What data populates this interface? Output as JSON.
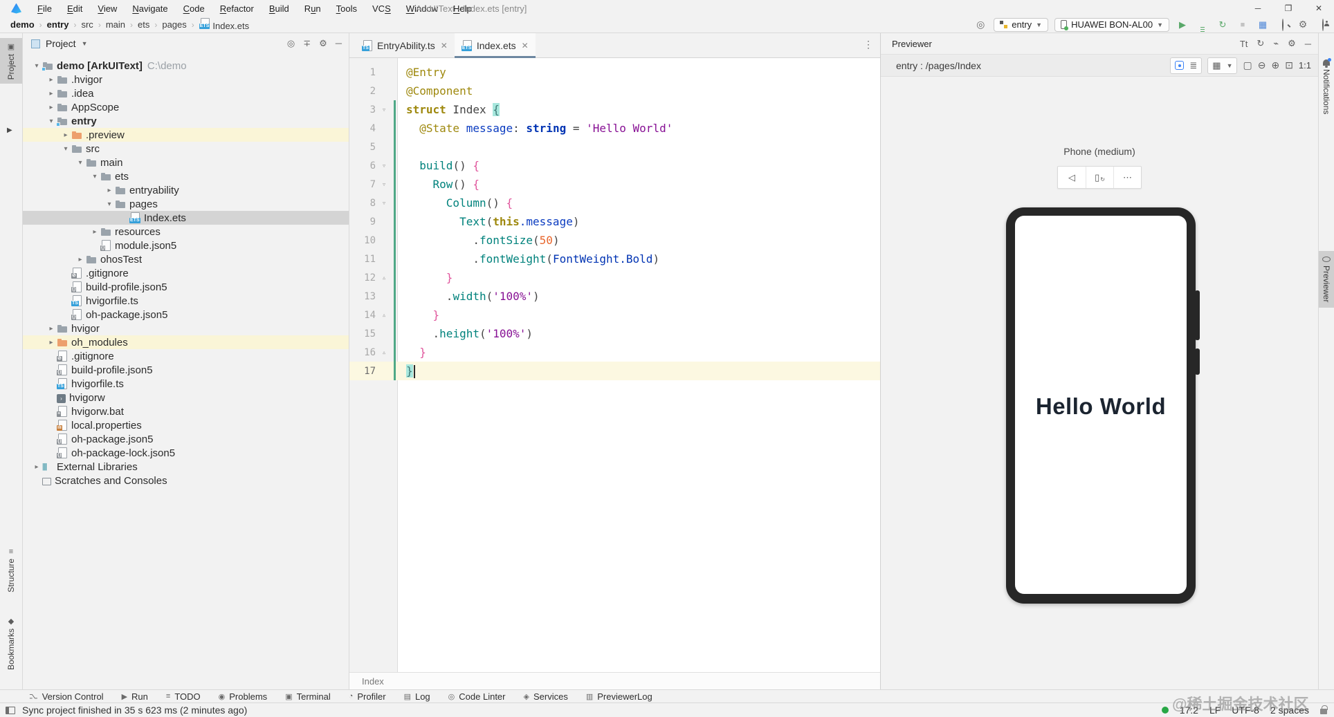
{
  "window": {
    "title": "ArkUIText - Index.ets [entry]"
  },
  "menubar": {
    "items": [
      {
        "label": "File",
        "mnemonic": 0
      },
      {
        "label": "Edit",
        "mnemonic": 0
      },
      {
        "label": "View",
        "mnemonic": 0
      },
      {
        "label": "Navigate",
        "mnemonic": 0
      },
      {
        "label": "Code",
        "mnemonic": 0
      },
      {
        "label": "Refactor",
        "mnemonic": 0
      },
      {
        "label": "Build",
        "mnemonic": 0
      },
      {
        "label": "Run",
        "mnemonic": 1
      },
      {
        "label": "Tools",
        "mnemonic": 0
      },
      {
        "label": "VCS",
        "mnemonic": 2
      },
      {
        "label": "Window",
        "mnemonic": 0
      },
      {
        "label": "Help",
        "mnemonic": 0
      }
    ]
  },
  "breadcrumbs": {
    "items": [
      "demo",
      "entry",
      "src",
      "main",
      "ets",
      "pages"
    ],
    "file": "Index.ets"
  },
  "toolbar": {
    "module": "entry",
    "device": "HUAWEI BON-AL00"
  },
  "left_stripe": {
    "tabs": [
      "Project",
      "Structure",
      "Bookmarks"
    ]
  },
  "project_panel": {
    "title": "Project",
    "tree": [
      {
        "label": "demo [ArkUIText]",
        "hint": "C:\\demo",
        "level": 0,
        "chev": "open",
        "icon": "module",
        "bold": true
      },
      {
        "label": ".hvigor",
        "level": 1,
        "chev": "closed",
        "icon": "folder"
      },
      {
        "label": ".idea",
        "level": 1,
        "chev": "closed",
        "icon": "folder"
      },
      {
        "label": "AppScope",
        "level": 1,
        "chev": "closed",
        "icon": "folder"
      },
      {
        "label": "entry",
        "level": 1,
        "chev": "open",
        "icon": "module",
        "bold": true
      },
      {
        "label": ".preview",
        "level": 2,
        "chev": "closed",
        "icon": "folder-orange",
        "row": "flagged"
      },
      {
        "label": "src",
        "level": 2,
        "chev": "open",
        "icon": "folder"
      },
      {
        "label": "main",
        "level": 3,
        "chev": "open",
        "icon": "folder"
      },
      {
        "label": "ets",
        "level": 4,
        "chev": "open",
        "icon": "folder"
      },
      {
        "label": "entryability",
        "level": 5,
        "chev": "closed",
        "icon": "folder"
      },
      {
        "label": "pages",
        "level": 5,
        "chev": "open",
        "icon": "folder"
      },
      {
        "label": "Index.ets",
        "level": 6,
        "chev": "none",
        "icon": "ets",
        "row": "selected"
      },
      {
        "label": "resources",
        "level": 4,
        "chev": "closed",
        "icon": "folder"
      },
      {
        "label": "module.json5",
        "level": 4,
        "chev": "none",
        "icon": "json5"
      },
      {
        "label": "ohosTest",
        "level": 3,
        "chev": "closed",
        "icon": "folder"
      },
      {
        "label": ".gitignore",
        "level": 2,
        "chev": "none",
        "icon": "ignore"
      },
      {
        "label": "build-profile.json5",
        "level": 2,
        "chev": "none",
        "icon": "json5"
      },
      {
        "label": "hvigorfile.ts",
        "level": 2,
        "chev": "none",
        "icon": "ts"
      },
      {
        "label": "oh-package.json5",
        "level": 2,
        "chev": "none",
        "icon": "json5"
      },
      {
        "label": "hvigor",
        "level": 1,
        "chev": "closed",
        "icon": "folder"
      },
      {
        "label": "oh_modules",
        "level": 1,
        "chev": "closed",
        "icon": "folder-orange",
        "row": "flagged"
      },
      {
        "label": ".gitignore",
        "level": 1,
        "chev": "none",
        "icon": "ignore"
      },
      {
        "label": "build-profile.json5",
        "level": 1,
        "chev": "none",
        "icon": "json5"
      },
      {
        "label": "hvigorfile.ts",
        "level": 1,
        "chev": "none",
        "icon": "ts"
      },
      {
        "label": "hvigorw",
        "level": 1,
        "chev": "none",
        "icon": "console"
      },
      {
        "label": "hvigorw.bat",
        "level": 1,
        "chev": "none",
        "icon": "bat"
      },
      {
        "label": "local.properties",
        "level": 1,
        "chev": "none",
        "icon": "props"
      },
      {
        "label": "oh-package.json5",
        "level": 1,
        "chev": "none",
        "icon": "json5"
      },
      {
        "label": "oh-package-lock.json5",
        "level": 1,
        "chev": "none",
        "icon": "json5"
      },
      {
        "label": "External Libraries",
        "level": 0,
        "chev": "closed",
        "icon": "lib"
      },
      {
        "label": "Scratches and Consoles",
        "level": 0,
        "chev": "none",
        "icon": "scratch"
      }
    ]
  },
  "editor": {
    "tabs": [
      {
        "label": "EntryAbility.ts",
        "kind": "ts",
        "active": false
      },
      {
        "label": "Index.ets",
        "kind": "ets",
        "active": true
      }
    ],
    "breadcrumb": "Index",
    "lines": [
      {
        "n": 1,
        "tok": [
          [
            "ann",
            "@Entry"
          ]
        ]
      },
      {
        "n": 2,
        "tok": [
          [
            "ann",
            "@Component"
          ]
        ]
      },
      {
        "n": 3,
        "fold": "open",
        "changed": true,
        "tok": [
          [
            "kw",
            "struct"
          ],
          [
            "pl",
            " Index "
          ],
          [
            "brhl",
            "{"
          ]
        ]
      },
      {
        "n": 4,
        "changed": true,
        "tok": [
          [
            "pl",
            "  "
          ],
          [
            "ann",
            "@State"
          ],
          [
            "pl",
            " "
          ],
          [
            "prop",
            "message"
          ],
          [
            "pl",
            ": "
          ],
          [
            "kwb",
            "string"
          ],
          [
            "pl",
            " = "
          ],
          [
            "str",
            "'Hello World'"
          ]
        ]
      },
      {
        "n": 5,
        "changed": true,
        "tok": []
      },
      {
        "n": 6,
        "fold": "open",
        "changed": true,
        "tok": [
          [
            "pl",
            "  "
          ],
          [
            "fn",
            "build"
          ],
          [
            "pl",
            "() "
          ],
          [
            "br",
            "{"
          ]
        ]
      },
      {
        "n": 7,
        "fold": "open",
        "changed": true,
        "tok": [
          [
            "pl",
            "    "
          ],
          [
            "fn",
            "Row"
          ],
          [
            "pl",
            "() "
          ],
          [
            "br",
            "{"
          ]
        ]
      },
      {
        "n": 8,
        "fold": "open",
        "changed": true,
        "tok": [
          [
            "pl",
            "      "
          ],
          [
            "fn",
            "Column"
          ],
          [
            "pl",
            "() "
          ],
          [
            "br",
            "{"
          ]
        ]
      },
      {
        "n": 9,
        "changed": true,
        "tok": [
          [
            "pl",
            "        "
          ],
          [
            "fn",
            "Text"
          ],
          [
            "pl",
            "("
          ],
          [
            "kw",
            "this"
          ],
          [
            "prop",
            ".message"
          ],
          [
            "pl",
            ")"
          ]
        ]
      },
      {
        "n": 10,
        "changed": true,
        "tok": [
          [
            "pl",
            "          ."
          ],
          [
            "fn",
            "fontSize"
          ],
          [
            "pl",
            "("
          ],
          [
            "num",
            "50"
          ],
          [
            "pl",
            ")"
          ]
        ]
      },
      {
        "n": 11,
        "changed": true,
        "tok": [
          [
            "pl",
            "          ."
          ],
          [
            "fn",
            "fontWeight"
          ],
          [
            "pl",
            "("
          ],
          [
            "cls",
            "FontWeight.Bold"
          ],
          [
            "pl",
            ")"
          ]
        ]
      },
      {
        "n": 12,
        "fold": "close",
        "changed": true,
        "tok": [
          [
            "pl",
            "      "
          ],
          [
            "br",
            "}"
          ]
        ]
      },
      {
        "n": 13,
        "changed": true,
        "tok": [
          [
            "pl",
            "      ."
          ],
          [
            "fn",
            "width"
          ],
          [
            "pl",
            "("
          ],
          [
            "str",
            "'100%'"
          ],
          [
            "pl",
            ")"
          ]
        ]
      },
      {
        "n": 14,
        "fold": "close",
        "changed": true,
        "tok": [
          [
            "pl",
            "    "
          ],
          [
            "br",
            "}"
          ]
        ]
      },
      {
        "n": 15,
        "changed": true,
        "tok": [
          [
            "pl",
            "    ."
          ],
          [
            "fn",
            "height"
          ],
          [
            "pl",
            "("
          ],
          [
            "str",
            "'100%'"
          ],
          [
            "pl",
            ")"
          ]
        ]
      },
      {
        "n": 16,
        "fold": "close",
        "changed": true,
        "tok": [
          [
            "pl",
            "  "
          ],
          [
            "br",
            "}"
          ]
        ]
      },
      {
        "n": 17,
        "changed": true,
        "cur": true,
        "caret": true,
        "tok": [
          [
            "brhl",
            "}"
          ]
        ]
      }
    ]
  },
  "previewer": {
    "title": "Previewer",
    "route": "entry : /pages/Index",
    "device_label": "Phone (medium)",
    "zoom_label": "1:1",
    "screen_text": "Hello World"
  },
  "right_stripe": {
    "tabs": [
      "Notifications",
      "Previewer"
    ]
  },
  "bottom_bar": {
    "items": [
      {
        "label": "Version Control",
        "icon": "branch-icon"
      },
      {
        "label": "Run",
        "icon": "run-icon"
      },
      {
        "label": "TODO",
        "icon": "todo-icon"
      },
      {
        "label": "Problems",
        "icon": "problems-icon"
      },
      {
        "label": "Terminal",
        "icon": "terminal-icon"
      },
      {
        "label": "Profiler",
        "icon": "profiler-icon"
      },
      {
        "label": "Log",
        "icon": "log-icon"
      },
      {
        "label": "Code Linter",
        "icon": "linter-icon"
      },
      {
        "label": "Services",
        "icon": "services-icon"
      },
      {
        "label": "PreviewerLog",
        "icon": "previewer-log-icon"
      }
    ]
  },
  "status_bar": {
    "message": "Sync project finished in 35 s 623 ms (2 minutes ago)",
    "caret_position": "17:2",
    "line_separator": "LF",
    "encoding": "UTF-8",
    "indent": "2 spaces"
  },
  "watermark": "@稀土掘金技术社区",
  "colors": {
    "chrome_bg": "#f2f2f2",
    "accent_blue": "#3b82f6",
    "run_green": "#59a869",
    "vcs_added": "#4fa987",
    "brace_match_bg": "#a7e7dd",
    "current_line_bg": "#fcf8e1",
    "selected_row": "#d4d4d4",
    "flagged_row": "#faf5d7",
    "string_purple": "#871094",
    "keyword_olive": "#9e880d",
    "function_teal": "#00827c",
    "number_orange": "#e8662c",
    "type_navy": "#0033b3"
  }
}
